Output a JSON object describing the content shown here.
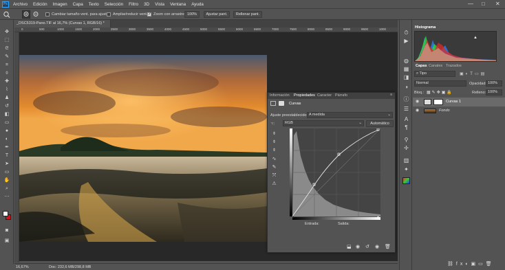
{
  "menu": [
    "Archivo",
    "Edición",
    "Imagen",
    "Capa",
    "Texto",
    "Selección",
    "Filtro",
    "3D",
    "Vista",
    "Ventana",
    "Ayuda"
  ],
  "app_logo": "Ps",
  "window_controls": {
    "minimize": "—",
    "maximize": "□",
    "close": "✕"
  },
  "options_bar": {
    "zoom_in_icon": "zoom-in-icon",
    "cb1_label": "Cambiar tamaño vent. para ajustar",
    "cb2_label": "Ampliar/reducir vent.",
    "cb3_label": "Zoom con arrastre",
    "zoom_value": "100%",
    "fit_label": "Ajustar pant.",
    "fill_label": "Rellenar pant."
  },
  "document": {
    "tab_title": "_DSC5319-Pano.TIF al 16,7% (Curvas 1, RGB/16) *",
    "close": "×",
    "ruler_numbers": [
      "0",
      "500",
      "1000",
      "1500",
      "2000",
      "2500",
      "3000",
      "3500",
      "4000",
      "4500",
      "5000",
      "5500",
      "6000",
      "6500",
      "7000",
      "7500",
      "8000",
      "8500",
      "9000",
      "9500",
      "1000"
    ],
    "zoom_status": "16,67%",
    "doc_status": "Doc: 232,6 MB/298,8 MB"
  },
  "histogram": {
    "title": "Histograma",
    "warn": "▲"
  },
  "layers_panel": {
    "tabs": [
      "Capas",
      "Canales",
      "Trazados"
    ],
    "filter_label": "Tipo",
    "blend_mode": "Normal",
    "opacity_label": "Opacidad:",
    "opacity_value": "100%",
    "lock_label": "Bloq.:",
    "fill_label": "Relleno:",
    "fill_value": "100%",
    "layers": [
      {
        "name": "Curvas 1"
      },
      {
        "name": "Fondo"
      }
    ]
  },
  "properties": {
    "tabs": [
      "Información",
      "Propiedades",
      "Caracter",
      "Párrafo"
    ],
    "header": "Curvas",
    "preset_label": "Ajuste preestablecido:",
    "preset_value": "A medida",
    "channel": "RGB",
    "auto_label": "Automático",
    "input_label": "Entrada:",
    "output_label": "Salida:"
  },
  "colors": {
    "panel_bg": "#535353",
    "canvas_bg": "#282828",
    "accent": "#31a8ff",
    "fg_color": "#ffffff",
    "bg_color": "#c8161d"
  }
}
